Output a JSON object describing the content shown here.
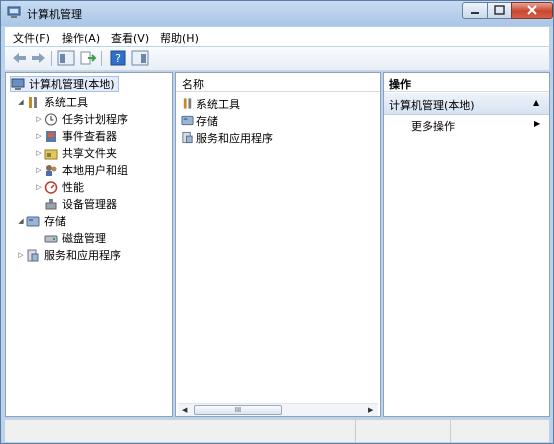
{
  "window": {
    "title": "计算机管理"
  },
  "menu": {
    "items": [
      "文件(F)",
      "操作(A)",
      "查看(V)",
      "帮助(H)"
    ]
  },
  "toolbar": {
    "buttons": [
      "back-arrow-icon",
      "forward-arrow-icon",
      "show-console-tree-icon",
      "export-list-icon",
      "help-icon",
      "show-action-pane-icon"
    ]
  },
  "tree": {
    "root": "计算机管理(本地)",
    "system_tools": "系统工具",
    "children": [
      "任务计划程序",
      "事件查看器",
      "共享文件夹",
      "本地用户和组",
      "性能",
      "设备管理器"
    ],
    "storage": "存储",
    "storage_children": [
      "磁盘管理"
    ],
    "services": "服务和应用程序"
  },
  "center": {
    "column_header": "名称",
    "items": [
      "系统工具",
      "存储",
      "服务和应用程序"
    ],
    "scroll_thumb": "III"
  },
  "actions": {
    "header": "操作",
    "group": "计算机管理(本地)",
    "items": [
      "更多操作"
    ]
  },
  "colors": {
    "accent": "#3c7fd4",
    "frame": "#bcd2ea",
    "close": "#c8462e"
  }
}
